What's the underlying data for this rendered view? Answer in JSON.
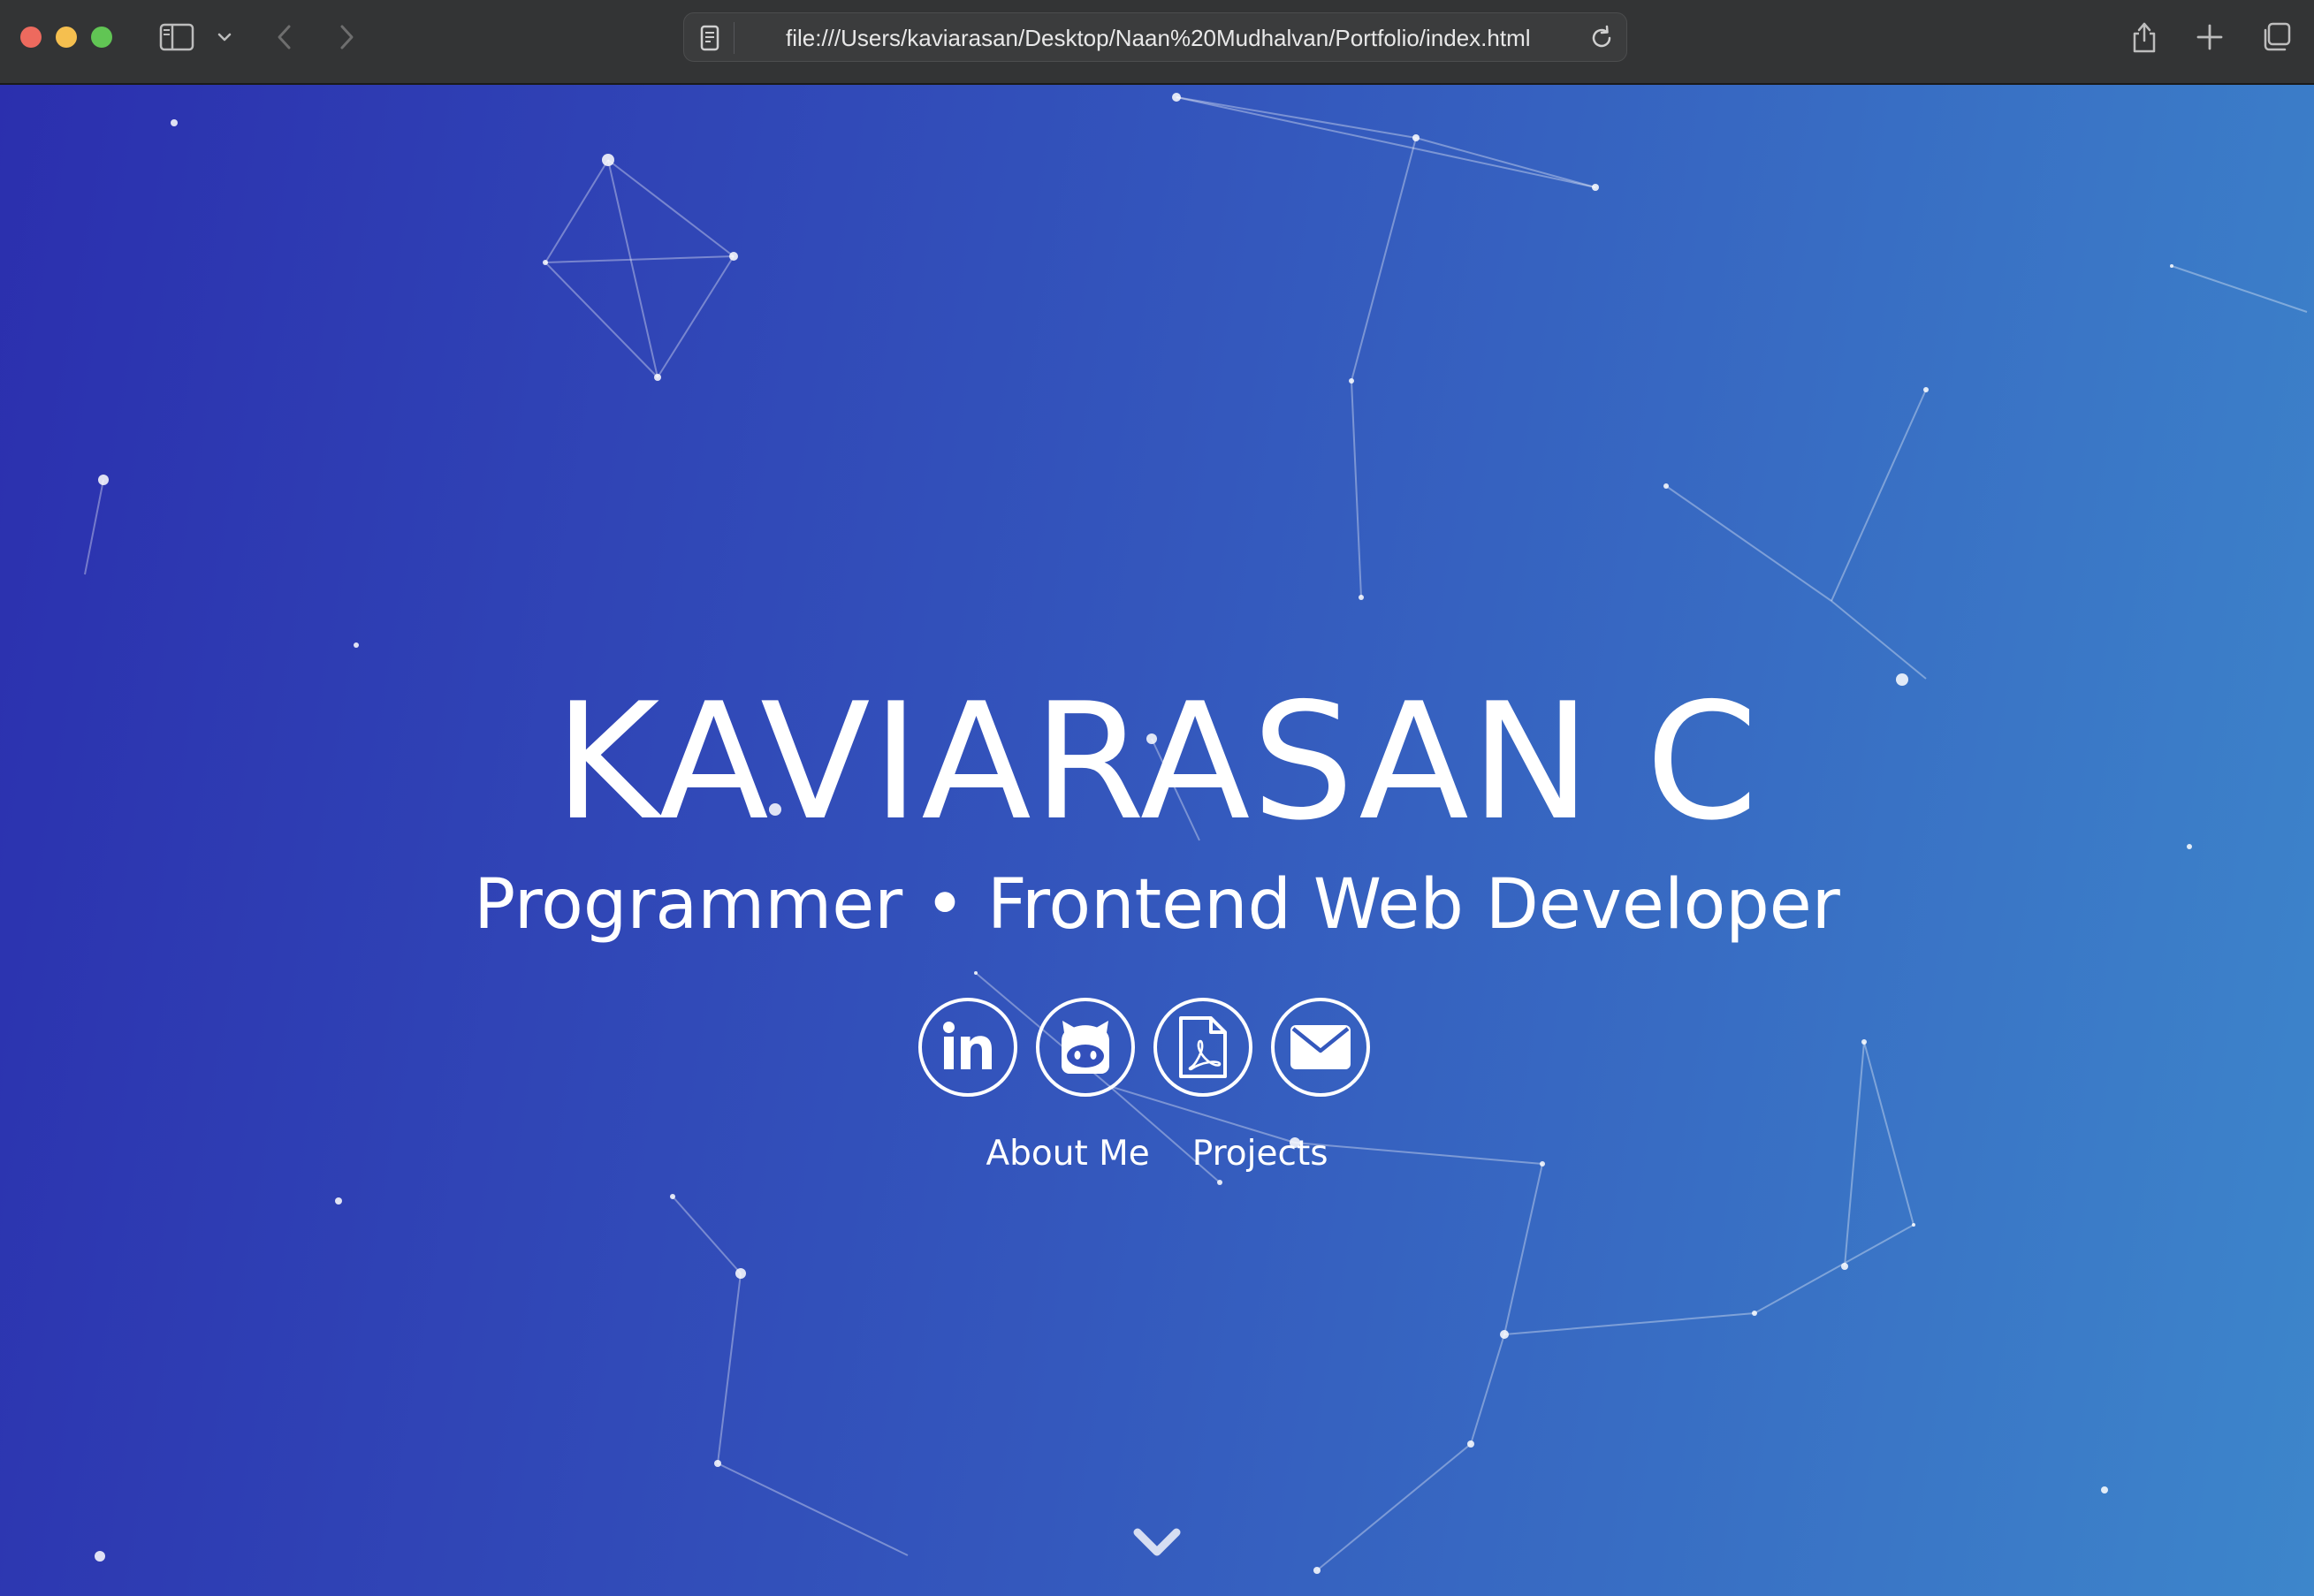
{
  "browser": {
    "url": "file:///Users/kaviarasan/Desktop/Naan%20Mudhalvan/Portfolio/index.html",
    "icons": {
      "close": "close-window",
      "minimize": "minimize-window",
      "zoom": "zoom-window",
      "sidebar": "sidebar-icon",
      "tab_menu": "chevron-down-icon",
      "back": "back-arrow-icon",
      "forward": "forward-arrow-icon",
      "page": "page-icon",
      "reload": "reload-icon",
      "share": "share-icon",
      "new_tab": "plus-icon",
      "tab_overview": "tabs-icon"
    }
  },
  "hero": {
    "name": "KAVIARASAN C",
    "tagline": "Programmer • Frontend Web Developer",
    "social": [
      {
        "icon": "linkedin-icon"
      },
      {
        "icon": "github-icon"
      },
      {
        "icon": "pdf-resume-icon"
      },
      {
        "icon": "email-icon"
      }
    ],
    "nav": [
      {
        "label": "About Me"
      },
      {
        "label": "Projects"
      }
    ],
    "scroll_icon": "chevron-down-icon"
  },
  "theme": {
    "gradient_start": "#2b2fae",
    "gradient_mid": "#3458bd",
    "gradient_end": "#3d86cb",
    "text": "#ffffff",
    "chrome_bg": "#333435"
  }
}
